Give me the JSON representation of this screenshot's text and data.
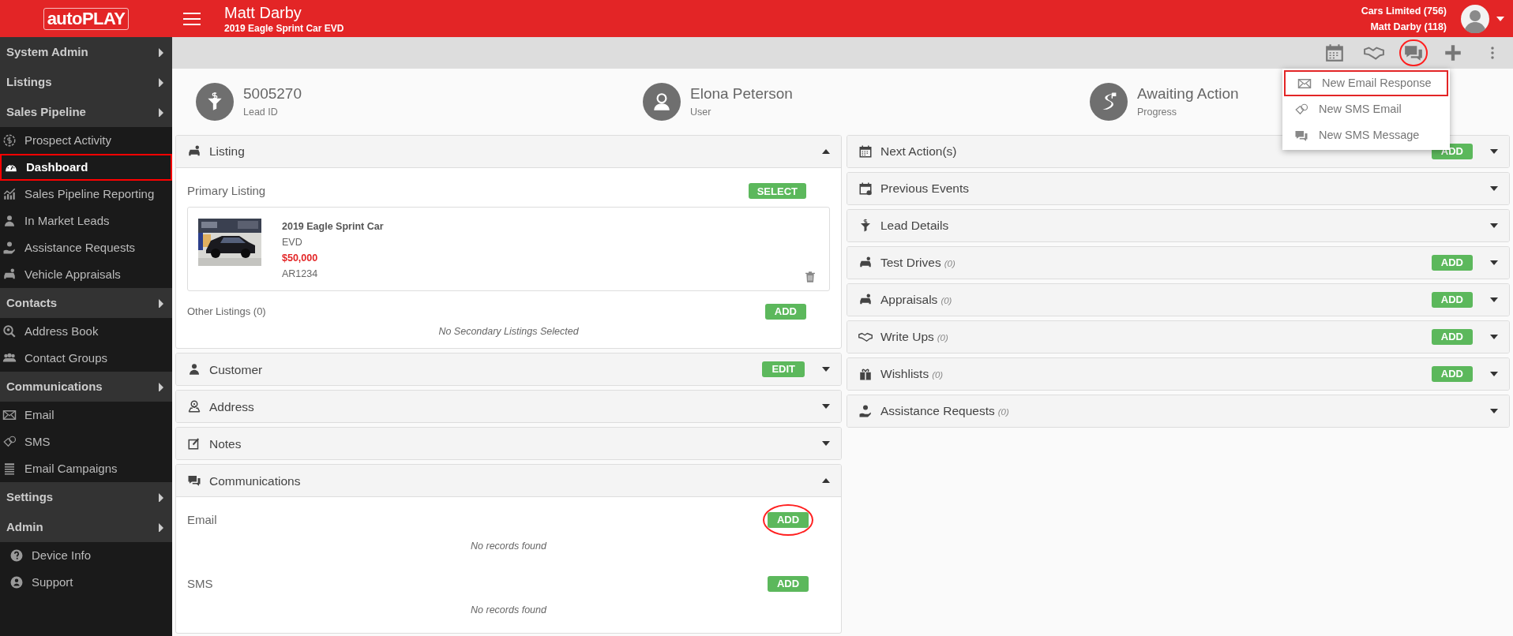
{
  "header": {
    "logo": "autoPLAY",
    "title": "Matt Darby",
    "subtitle": "2019 Eagle Sprint Car EVD",
    "account_lines": [
      "Cars Limited (756)",
      "Matt Darby (118)"
    ]
  },
  "sidebar": [
    {
      "kind": "section",
      "label": "System Admin"
    },
    {
      "kind": "section",
      "label": "Listings"
    },
    {
      "kind": "section",
      "label": "Sales Pipeline"
    },
    {
      "kind": "item",
      "label": "Prospect Activity",
      "selected": false
    },
    {
      "kind": "item",
      "label": "Dashboard",
      "selected": true
    },
    {
      "kind": "item",
      "label": "Sales Pipeline Reporting",
      "selected": false
    },
    {
      "kind": "item",
      "label": "In Market Leads",
      "selected": false
    },
    {
      "kind": "item",
      "label": "Assistance Requests",
      "selected": false
    },
    {
      "kind": "item",
      "label": "Vehicle Appraisals",
      "selected": false
    },
    {
      "kind": "section",
      "label": "Contacts"
    },
    {
      "kind": "item",
      "label": "Address Book",
      "selected": false
    },
    {
      "kind": "item",
      "label": "Contact Groups",
      "selected": false
    },
    {
      "kind": "section",
      "label": "Communications"
    },
    {
      "kind": "item",
      "label": "Email",
      "selected": false
    },
    {
      "kind": "item",
      "label": "SMS",
      "selected": false
    },
    {
      "kind": "item",
      "label": "Email Campaigns",
      "selected": false
    },
    {
      "kind": "section",
      "label": "Settings"
    },
    {
      "kind": "section",
      "label": "Admin"
    },
    {
      "kind": "subitem",
      "label": "Device Info",
      "selected": false
    },
    {
      "kind": "subitem",
      "label": "Support",
      "selected": false
    }
  ],
  "toolbar": [
    {
      "circled": false
    },
    {
      "circled": false
    },
    {
      "circled": true
    },
    {
      "circled": false
    },
    {
      "circled": false
    }
  ],
  "menu": [
    {
      "label": "New Email Response",
      "highlighted": true
    },
    {
      "label": "New SMS Email",
      "highlighted": false
    },
    {
      "label": "New SMS Message",
      "highlighted": false
    }
  ],
  "summary": [
    {
      "value": "5005270",
      "label": "Lead ID"
    },
    {
      "value": "Elona Peterson",
      "label": "User"
    },
    {
      "value": "Awaiting Action",
      "label": "Progress"
    }
  ],
  "left_panels": [
    {
      "kind": "listing",
      "title": "Listing",
      "expanded": true,
      "primary_label": "Primary Listing",
      "select_button": "SELECT",
      "listing": {
        "title": "2019 Eagle Sprint Car",
        "variant": "EVD",
        "price": "$50,000",
        "stock": "AR1234"
      },
      "other_label": "Other Listings (0)",
      "add_button": "ADD",
      "empty": "No Secondary Listings Selected"
    },
    {
      "kind": "plain",
      "title": "Customer",
      "expanded": false,
      "button": "EDIT"
    },
    {
      "kind": "plain",
      "title": "Address",
      "expanded": false
    },
    {
      "kind": "plain",
      "title": "Notes",
      "expanded": false
    },
    {
      "kind": "communications",
      "title": "Communications",
      "expanded": true,
      "sections": [
        {
          "label": "Email",
          "button": "ADD",
          "circled": true,
          "empty": "No records found"
        },
        {
          "label": "SMS",
          "button": "ADD",
          "circled": false,
          "empty": "No records found"
        }
      ]
    }
  ],
  "right_panels": [
    {
      "title": "Next Action(s)",
      "button": "ADD",
      "expanded": false
    },
    {
      "title": "Previous Events",
      "expanded": false
    },
    {
      "title": "Lead Details",
      "expanded": false
    },
    {
      "title": "Test Drives",
      "count": "(0)",
      "button": "ADD",
      "expanded": false
    },
    {
      "title": "Appraisals",
      "count": "(0)",
      "button": "ADD",
      "expanded": false
    },
    {
      "title": "Write Ups",
      "count": "(0)",
      "button": "ADD",
      "expanded": false
    },
    {
      "title": "Wishlists",
      "count": "(0)",
      "button": "ADD",
      "expanded": false
    },
    {
      "title": "Assistance Requests",
      "count": "(0)",
      "expanded": false
    }
  ]
}
